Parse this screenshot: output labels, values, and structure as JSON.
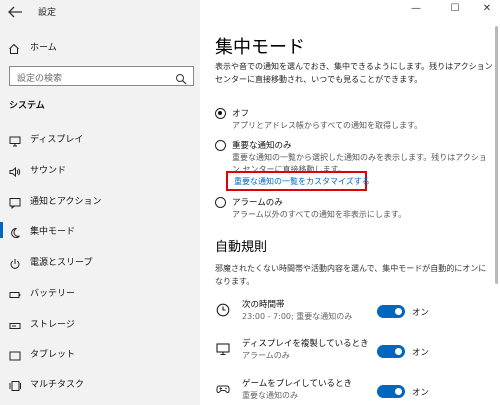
{
  "window": {
    "title": "設定",
    "controls": {
      "minimize": "—",
      "maximize": "☐",
      "close": "✕"
    }
  },
  "sidebar": {
    "home_label": "ホーム",
    "search_placeholder": "設定の検索",
    "section_title": "システム",
    "items": [
      {
        "label": "ディスプレイ",
        "icon": "monitor-icon",
        "active": false
      },
      {
        "label": "サウンド",
        "icon": "speaker-icon",
        "active": false
      },
      {
        "label": "通知とアクション",
        "icon": "notification-icon",
        "active": false
      },
      {
        "label": "集中モード",
        "icon": "moon-icon",
        "active": true
      },
      {
        "label": "電源とスリープ",
        "icon": "power-icon",
        "active": false
      },
      {
        "label": "バッテリー",
        "icon": "battery-icon",
        "active": false
      },
      {
        "label": "ストレージ",
        "icon": "storage-icon",
        "active": false
      },
      {
        "label": "タブレット",
        "icon": "tablet-icon",
        "active": false
      },
      {
        "label": "マルチタスク",
        "icon": "multitask-icon",
        "active": false
      }
    ]
  },
  "main": {
    "title": "集中モード",
    "description": "表示や音での通知を選んでおき、集中できるようにします。残りはアクション センターに直接移動され、いつでも見ることができます。",
    "options": [
      {
        "label": "オフ",
        "desc": "アプリとアドレス帳からすべての通知を取得します。",
        "selected": true
      },
      {
        "label": "重要な通知のみ",
        "desc": "重要な通知の一覧から選択した通知のみを表示します。残りはアクション センターに直接移動します。",
        "selected": false
      },
      {
        "label": "アラームのみ",
        "desc": "アラーム以外のすべての通知を非表示にします。",
        "selected": false
      }
    ],
    "customize_link": "重要な通知の一覧をカスタマイズする",
    "auto_rules": {
      "title": "自動規則",
      "description": "邪魔されたくない時間帯や活動内容を選んで、集中モードが自動的にオンになります。",
      "rules": [
        {
          "title": "次の時間帯",
          "subtitle": "23:00 - 7:00; 重要な通知のみ",
          "toggle_label": "オン",
          "on": true,
          "icon": "clock-icon"
        },
        {
          "title": "ディスプレイを複製しているとき",
          "subtitle": "アラームのみ",
          "toggle_label": "オン",
          "on": true,
          "icon": "monitor-icon"
        },
        {
          "title": "ゲームをプレイしているとき",
          "subtitle": "重要な通知のみ",
          "toggle_label": "オン",
          "on": true,
          "icon": "gamepad-icon"
        }
      ]
    }
  },
  "colors": {
    "accent": "#0067c0",
    "highlight_box": "#e0000a",
    "sidebar_bg": "#f2f2f2"
  }
}
